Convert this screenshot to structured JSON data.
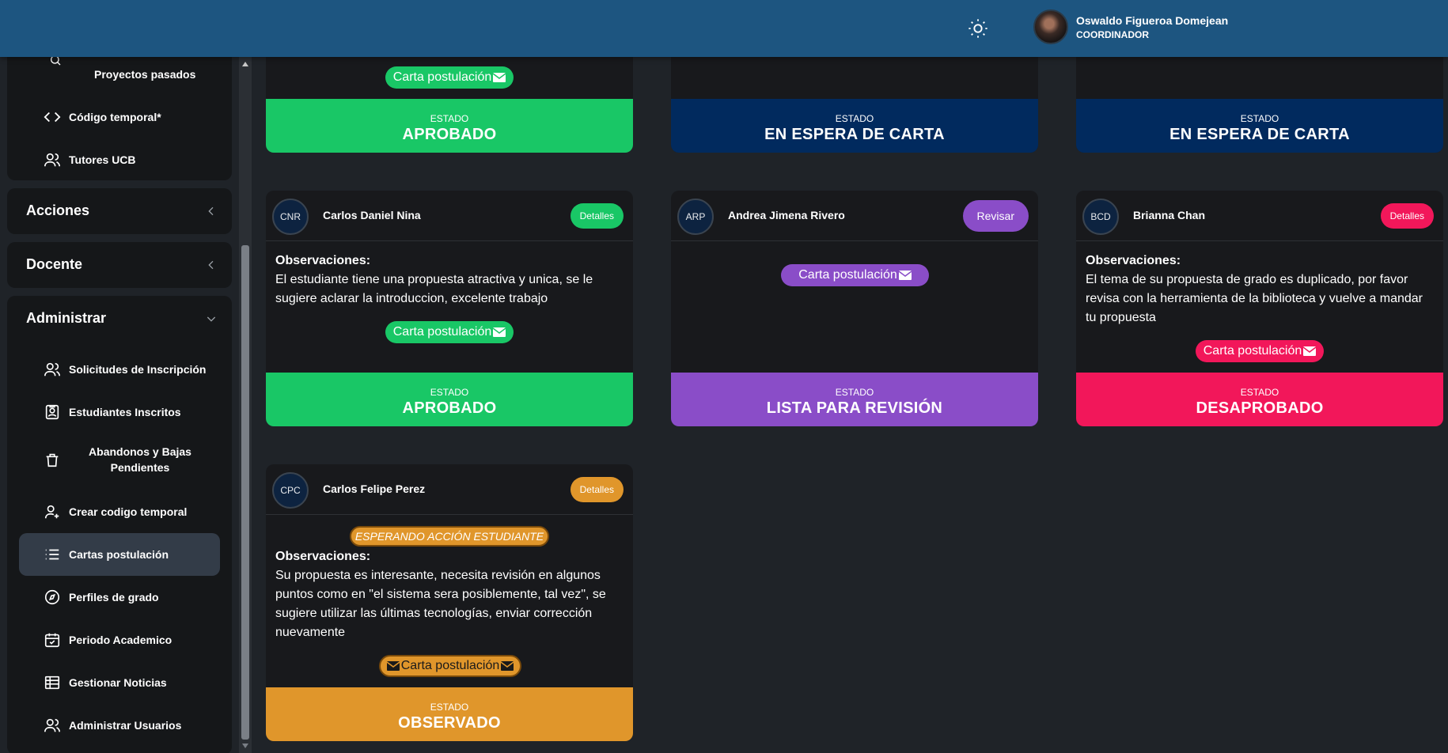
{
  "header": {
    "theme_icon": "sun-icon",
    "user_name": "Oswaldo Figueroa Domejean",
    "user_role": "COORDINADOR"
  },
  "sidebar": {
    "top_items": [
      {
        "label": "Proyectos pasados",
        "icon": "search-icon"
      },
      {
        "label": "Código temporal*",
        "icon": "code-icon"
      },
      {
        "label": "Tutores UCB",
        "icon": "users-icon"
      }
    ],
    "sections": {
      "acciones": "Acciones",
      "docente": "Docente",
      "administrar": "Administrar"
    },
    "admin_items": [
      {
        "label": "Solicitudes de Inscripción",
        "icon": "users-icon"
      },
      {
        "label": "Estudiantes Inscritos",
        "icon": "id-badge-icon"
      },
      {
        "label": "Abandonos y Bajas Pendientes",
        "icon": "trash-icon"
      },
      {
        "label": "Crear codigo temporal",
        "icon": "user-plus-icon"
      },
      {
        "label": "Cartas postulación",
        "icon": "list-icon"
      },
      {
        "label": "Perfiles de grado",
        "icon": "compass-icon"
      },
      {
        "label": "Periodo Academico",
        "icon": "calendar-icon"
      },
      {
        "label": "Gestionar Noticias",
        "icon": "table-icon"
      },
      {
        "label": "Administrar Usuarios",
        "icon": "users-icon"
      }
    ]
  },
  "common": {
    "estado_label": "ESTADO",
    "carta_label": "Carta postulación"
  },
  "cards": {
    "top": [
      {
        "status": "APROBADO",
        "status_color": "#19c766",
        "carta_color": "#19c766"
      },
      {
        "status": "EN ESPERA DE CARTA",
        "status_color": "#012a5e"
      },
      {
        "status": "EN ESPERA DE CARTA",
        "status_color": "#012a5e"
      }
    ],
    "row2": [
      {
        "initials": "CNR",
        "name": "Carlos Daniel Nina",
        "button": "Detalles",
        "button_color": "#19c766",
        "obs_title": "Observaciones:",
        "obs_text": "El estudiante tiene una propuesta atractiva y unica, se le sugiere aclarar la introduccion, excelente trabajo",
        "status": "APROBADO",
        "status_color": "#19c766"
      },
      {
        "initials": "ARP",
        "name": "Andrea Jimena Rivero",
        "button": "Revisar",
        "button_color": "#8a4dc8",
        "status": "LISTA PARA REVISIÓN",
        "status_color": "#8a4dc8"
      },
      {
        "initials": "BCD",
        "name": "Brianna Chan",
        "button": "Detalles",
        "button_color": "#f2175a",
        "obs_title": "Observaciones:",
        "obs_text": "El tema de su propuesta de grado es duplicado, por favor revisa con la herramienta de la biblioteca y vuelve a mandar tu propuesta",
        "status": "DESAPROBADO",
        "status_color": "#f2175a"
      }
    ],
    "row3": [
      {
        "initials": "CPC",
        "name": "Carlos Felipe Perez",
        "button": "Detalles",
        "button_color": "#e0962b",
        "badge": "ESPERANDO ACCIÓN ESTUDIANTE",
        "obs_title": "Observaciones:",
        "obs_text": "Su propuesta es interesante, necesita revisión en algunos puntos como en \"el sistema sera posiblemente, tal vez\", se sugiere utilizar las últimas tecnologías, enviar corrección nuevamente",
        "status": "OBSERVADO",
        "status_color": "#e0962b"
      }
    ]
  }
}
